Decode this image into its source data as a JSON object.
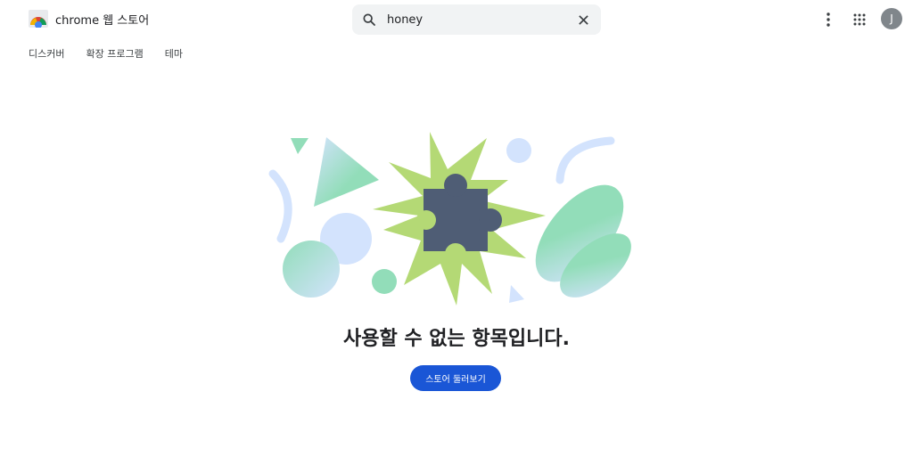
{
  "header": {
    "store_title": "chrome 웹 스토어",
    "search_value": "honey"
  },
  "nav": {
    "items": [
      "디스커버",
      "확장 프로그램",
      "테마"
    ]
  },
  "user": {
    "avatar_initial": "J"
  },
  "main": {
    "message": "사용할 수 없는 항목입니다.",
    "cta_label": "스토어 둘러보기"
  },
  "colors": {
    "accent": "#1a56d6",
    "green_star": "#b4d975",
    "mint": "#92ddb9",
    "light_blue": "#d3e3fd",
    "puzzle": "#4f5d75",
    "avatar_bg": "#80868b"
  },
  "icons": [
    "chrome-web-store-logo-icon",
    "search-icon",
    "close-icon",
    "more-vert-icon",
    "apps-grid-icon",
    "puzzle-icon"
  ]
}
